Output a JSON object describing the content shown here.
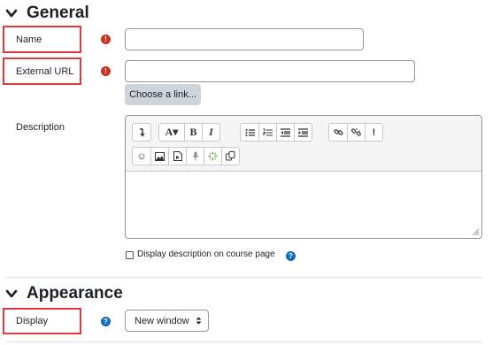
{
  "general": {
    "heading": "General",
    "name_label": "Name",
    "name_value": "",
    "external_url_label": "External URL",
    "external_url_value": "",
    "choose_link_label": "Choose a link...",
    "description_label": "Description",
    "display_description_label": "Display description on course page",
    "required_icon": "exclamation-icon",
    "help_icon": "question-icon"
  },
  "editor": {
    "toolbar_row1": [
      {
        "name": "show-more-icon",
        "glyph": "↴"
      },
      {
        "name": "paragraph-styles-icon",
        "glyph": "A▾"
      },
      {
        "name": "bold-icon",
        "glyph": "B"
      },
      {
        "name": "italic-icon",
        "glyph": "I"
      },
      {
        "name": "unordered-list-icon",
        "glyph": "☰"
      },
      {
        "name": "ordered-list-icon",
        "glyph": "☷"
      },
      {
        "name": "outdent-icon",
        "glyph": "⇤"
      },
      {
        "name": "indent-icon",
        "glyph": "⇥"
      },
      {
        "name": "link-icon",
        "glyph": "🔗"
      },
      {
        "name": "unlink-icon",
        "glyph": "⛓"
      },
      {
        "name": "warning-icon",
        "glyph": "!"
      }
    ],
    "toolbar_row2": [
      {
        "name": "emoji-icon",
        "glyph": "☺"
      },
      {
        "name": "image-icon",
        "glyph": "▣"
      },
      {
        "name": "media-icon",
        "glyph": "▤"
      },
      {
        "name": "record-audio-icon",
        "glyph": "🎙"
      },
      {
        "name": "h5p-icon",
        "glyph": "✳"
      },
      {
        "name": "copy-icon",
        "glyph": "⧉"
      }
    ]
  },
  "appearance": {
    "heading": "Appearance",
    "display_label": "Display",
    "display_value": "New window"
  },
  "colors": {
    "label_outline": "#e0393e",
    "required": "#ca3120",
    "help": "#0f6cbf",
    "button_bg": "#ced4da"
  }
}
